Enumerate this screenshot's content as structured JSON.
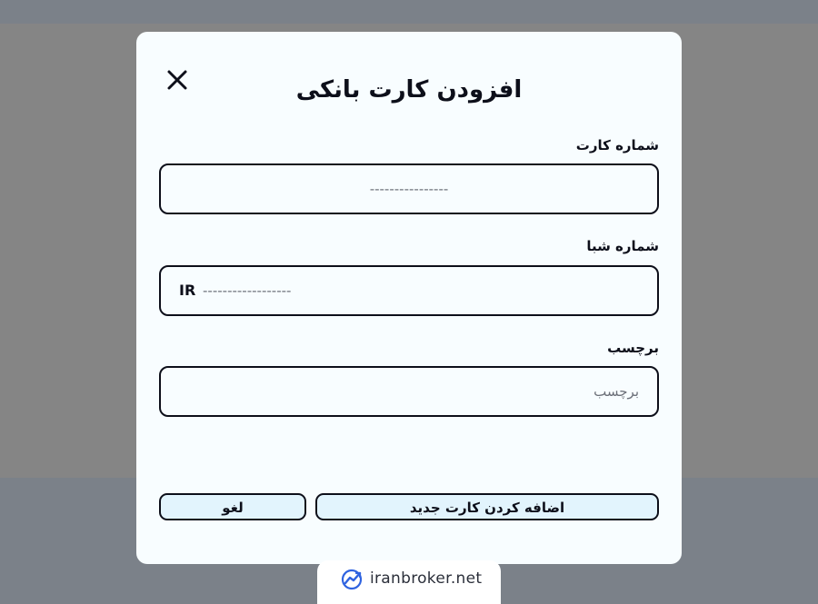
{
  "modal": {
    "title": "افزودن کارت بانکی",
    "close_icon": "close-icon"
  },
  "fields": {
    "card_number": {
      "label": "شماره کارت",
      "placeholder": "----------------",
      "value": ""
    },
    "iban": {
      "label": "شماره شبا",
      "prefix": "IR",
      "placeholder": "------------------",
      "value": ""
    },
    "tag": {
      "label": "برچسب",
      "placeholder": "برچسب",
      "value": ""
    }
  },
  "buttons": {
    "add_label": "اضافه کردن کارت جدید",
    "cancel_label": "لغو"
  },
  "watermark": {
    "text": "iranbroker.net",
    "icon": "trend-chart-icon"
  },
  "colors": {
    "backdrop": "#858585",
    "modal_background": "#f8fdff",
    "border": "#0d0f1a",
    "button_background": "#e2f4fd",
    "watermark_icon": "#2f63e0"
  }
}
